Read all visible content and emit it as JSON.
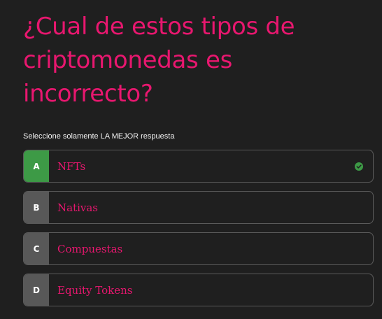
{
  "question": {
    "title": "¿Cual de estos tipos de criptomonedas es incorrecto?",
    "instruction": "Seleccione solamente LA MEJOR respuesta"
  },
  "options": [
    {
      "letter": "A",
      "label": "NFTs",
      "selected": true
    },
    {
      "letter": "B",
      "label": "Nativas",
      "selected": false
    },
    {
      "letter": "C",
      "label": "Compuestas",
      "selected": false
    },
    {
      "letter": "D",
      "label": "Equity Tokens",
      "selected": false
    }
  ],
  "icons": {
    "selected_indicator": "check-circle-icon"
  },
  "colors": {
    "background": "#1f1f1f",
    "accent": "#e8176f",
    "selected": "#3d9a46",
    "letter_box": "#585858"
  }
}
